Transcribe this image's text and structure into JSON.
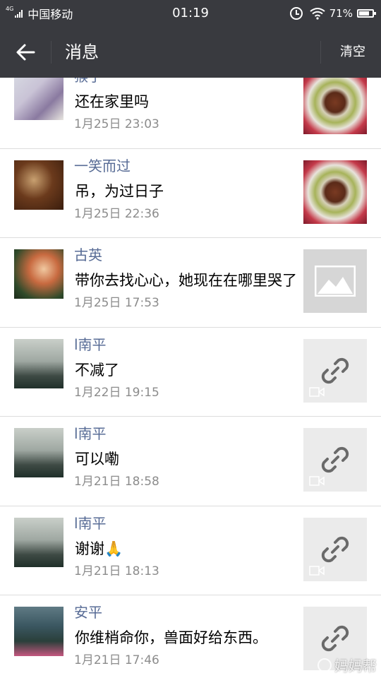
{
  "status_bar": {
    "network": "4G",
    "carrier": "中国移动",
    "time": "01:19",
    "battery_percent": "71%"
  },
  "header": {
    "title": "消息",
    "clear_label": "清空"
  },
  "messages": [
    {
      "name": "猴子",
      "text": "还在家里吗",
      "time": "1月25日 23:03",
      "avatar": "avatar-photo",
      "thumbnail": "food-photo"
    },
    {
      "name": "一笑而过",
      "text": "吊，为过日子",
      "time": "1月25日 22:36",
      "avatar": "avatar-photo",
      "thumbnail": "food-photo"
    },
    {
      "name": "古英",
      "text": "带你去找心心，她现在在哪里哭了",
      "time": "1月25日 17:53",
      "avatar": "avatar-photo",
      "thumbnail": "image-placeholder-icon"
    },
    {
      "name": "l南平",
      "text": "不减了",
      "time": "1月22日 19:15",
      "avatar": "avatar-photo",
      "thumbnail": "link-icon"
    },
    {
      "name": "l南平",
      "text": "可以嘞",
      "time": "1月21日 18:58",
      "avatar": "avatar-photo",
      "thumbnail": "link-icon"
    },
    {
      "name": "l南平",
      "text": "谢谢🙏",
      "time": "1月21日 18:13",
      "avatar": "avatar-photo",
      "thumbnail": "link-icon"
    },
    {
      "name": "安平",
      "text": "你维梢命你，兽面好给东西。",
      "time": "1月21日 17:46",
      "avatar": "avatar-photo",
      "thumbnail": "link-icon"
    }
  ],
  "watermark": "妈妈帮",
  "colors": {
    "header_bg": "#393a3f",
    "name_color": "#576b95",
    "time_color": "#8c8c8c"
  }
}
